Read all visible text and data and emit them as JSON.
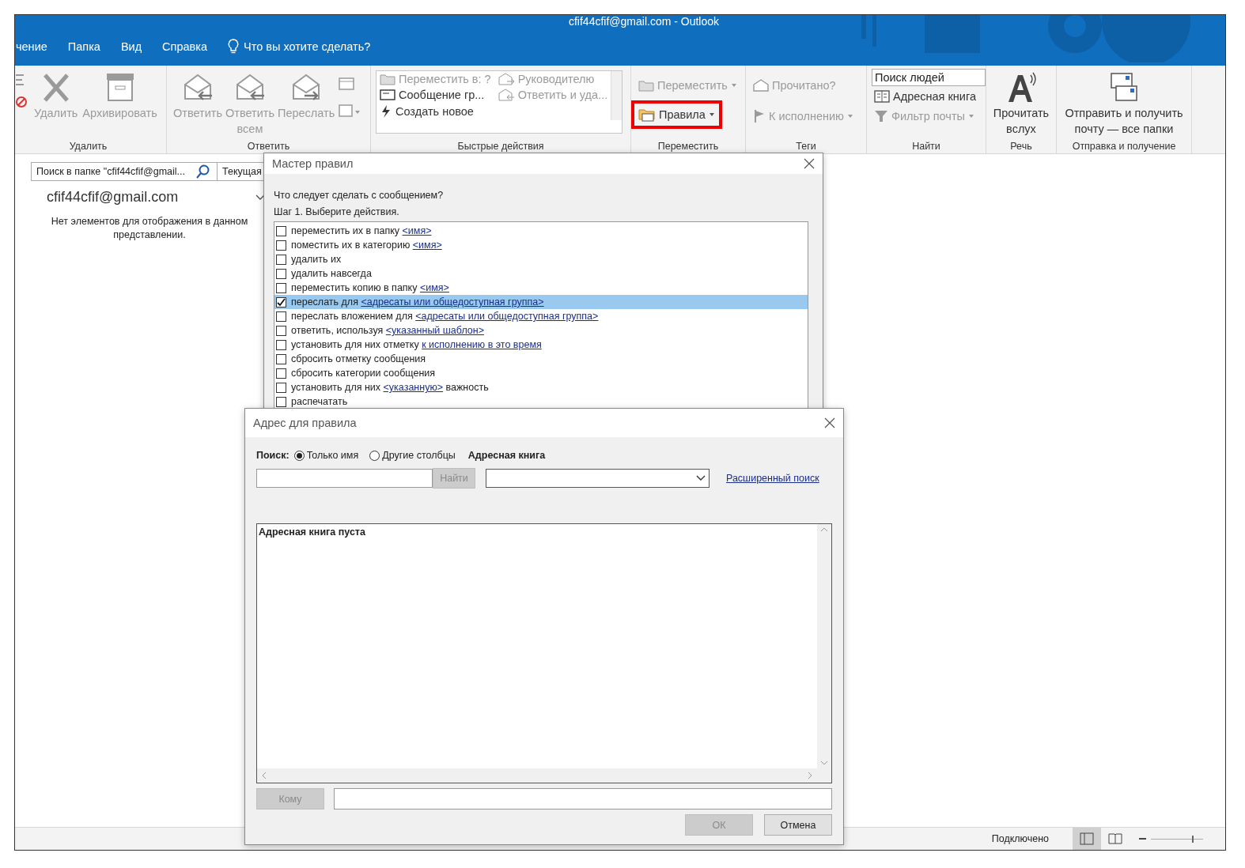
{
  "window": {
    "title": "cfif44cfif@gmail.com  -  Outlook"
  },
  "tabs": [
    {
      "label": "чение",
      "selected": false
    },
    {
      "label": "Папка",
      "selected": false
    },
    {
      "label": "Вид",
      "selected": false
    },
    {
      "label": "Справка",
      "selected": false
    }
  ],
  "tell_me": {
    "placeholder": "Что вы хотите сделать?"
  },
  "ribbon": {
    "delete_group": {
      "label": "Удалить",
      "buttons": [
        {
          "label": "Удалить",
          "disabled": true
        },
        {
          "label": "Архивировать",
          "disabled": true
        }
      ]
    },
    "respond_group": {
      "label": "Ответить",
      "buttons": [
        {
          "label": "Ответить",
          "disabled": true
        },
        {
          "label": "Ответить всем",
          "disabled": true
        },
        {
          "label": "Переслать",
          "disabled": true
        }
      ]
    },
    "quick_steps": {
      "label": "Быстрые действия",
      "items": [
        {
          "label": "Переместить в: ?",
          "disabled": true
        },
        {
          "label": "Руководителю",
          "disabled": true
        },
        {
          "label": "Сообщение гр...",
          "disabled": false
        },
        {
          "label": "Ответить и уда...",
          "disabled": true
        },
        {
          "label": "Создать новое",
          "disabled": false
        }
      ]
    },
    "move_group": {
      "label": "Переместить",
      "buttons": [
        {
          "label": "Переместить",
          "disabled": true,
          "highlighted": false
        },
        {
          "label": "Правила",
          "disabled": false,
          "highlighted": true
        }
      ]
    },
    "tags_group": {
      "label": "Теги",
      "buttons": [
        {
          "label": "Прочитано?",
          "disabled": true
        },
        {
          "label": "К исполнению",
          "disabled": true
        }
      ]
    },
    "find_group": {
      "label": "Найти",
      "search": {
        "placeholder": "Поиск людей"
      },
      "buttons": [
        {
          "label": "Адресная книга",
          "disabled": false
        },
        {
          "label": "Фильтр почты",
          "disabled": true
        }
      ]
    },
    "speech_group": {
      "label": "Речь",
      "buttons": [
        {
          "label": "Прочитать вслух",
          "disabled": false
        }
      ]
    },
    "send_group": {
      "label": "Отправка и получение",
      "buttons": [
        {
          "label": "Отправить и получить почту — все папки",
          "disabled": false
        }
      ]
    }
  },
  "folder_pane": {
    "search": {
      "placeholder": "Поиск в папке \"cfif44cfif@gmail..."
    },
    "scope": "Текущая",
    "account": "cfif44cfif@gmail.com",
    "empty_message": "Нет элементов для отображения в данном представлении."
  },
  "status_bar": {
    "status": "Подключено",
    "zoom": {
      "level": 0.82
    }
  },
  "rules_dialog": {
    "title": "Мастер правил",
    "question": "Что следует сделать с сообщением?",
    "step": "Шаг 1. Выберите действия.",
    "actions": [
      {
        "text": "переместить их в папку",
        "link": "<имя>",
        "checked": false,
        "selected": false
      },
      {
        "text": "поместить их в категорию",
        "link": "<имя>",
        "checked": false,
        "selected": false
      },
      {
        "text": "удалить их",
        "checked": false,
        "selected": false
      },
      {
        "text": "удалить навсегда",
        "checked": false,
        "selected": false
      },
      {
        "text": "переместить копию в папку",
        "link": "<имя>",
        "checked": false,
        "selected": false
      },
      {
        "text": "переслать для",
        "link": "<адресаты или общедоступная группа>",
        "checked": true,
        "selected": true
      },
      {
        "text": "переслать вложением для",
        "link": "<адресаты или общедоступная группа>",
        "checked": false,
        "selected": false
      },
      {
        "text": "ответить, используя",
        "link": "<указанный шаблон>",
        "checked": false,
        "selected": false
      },
      {
        "text": "установить для них отметку",
        "link": "к исполнению в это время",
        "checked": false,
        "selected": false
      },
      {
        "text": "сбросить отметку сообщения",
        "checked": false,
        "selected": false
      },
      {
        "text": "сбросить категории сообщения",
        "checked": false,
        "selected": false
      },
      {
        "text": "установить для них",
        "link": "<указанную>",
        "after": "важность",
        "checked": false,
        "selected": false
      },
      {
        "text": "распечатать",
        "checked": false,
        "selected": false
      }
    ]
  },
  "address_dialog": {
    "title": "Адрес для правила",
    "search_label": "Поиск:",
    "search_options": [
      {
        "label": "Только имя",
        "selected": true
      },
      {
        "label": "Другие столбцы",
        "selected": false
      }
    ],
    "address_book_label": "Адресная книга",
    "find_button": {
      "label": "Найти",
      "disabled": true
    },
    "advanced_search": "Расширенный поиск",
    "list_header": "Адресная книга пуста",
    "to_button": {
      "label": "Кому",
      "disabled": true
    },
    "ok_button": {
      "label": "ОК",
      "disabled": true
    },
    "cancel_button": {
      "label": "Отмена",
      "disabled": false
    }
  }
}
